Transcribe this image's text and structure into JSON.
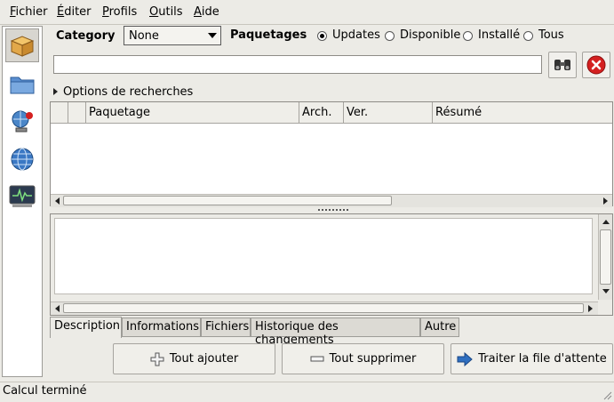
{
  "menubar": {
    "items": [
      {
        "label": "Fichier",
        "underline": "F",
        "rest": "ichier"
      },
      {
        "label": "Éditer",
        "underline": "É",
        "rest": "diter"
      },
      {
        "label": "Profils",
        "underline": "P",
        "rest": "rofils"
      },
      {
        "label": "Outils",
        "underline": "O",
        "rest": "utils"
      },
      {
        "label": "Aide",
        "underline": "A",
        "rest": "ide"
      }
    ]
  },
  "sidebar": {
    "items": [
      {
        "icon": "package-box-icon",
        "active": true
      },
      {
        "icon": "folder-icon",
        "active": false
      },
      {
        "icon": "network-update-icon",
        "active": false
      },
      {
        "icon": "globe-icon",
        "active": false
      },
      {
        "icon": "system-monitor-icon",
        "active": false
      }
    ]
  },
  "filters": {
    "category_label": "Category",
    "category_value": "None",
    "paquetages_label": "Paquetages",
    "radios": [
      {
        "label": "Updates",
        "selected": true
      },
      {
        "label": "Disponible",
        "selected": false
      },
      {
        "label": "Installé",
        "selected": false
      },
      {
        "label": "Tous",
        "selected": false
      }
    ]
  },
  "search": {
    "value": ""
  },
  "options": {
    "label": "Options de recherches"
  },
  "table": {
    "columns": [
      "",
      "",
      "Paquetage",
      "Arch.",
      "Ver.",
      "Résumé"
    ],
    "rows": []
  },
  "tabs": [
    {
      "label": "Description",
      "active": true
    },
    {
      "label": "Informations",
      "active": false
    },
    {
      "label": "Fichiers",
      "active": false
    },
    {
      "label": "Historique des changements",
      "active": false
    },
    {
      "label": "Autre",
      "active": false
    }
  ],
  "actions": {
    "add_all": "Tout ajouter",
    "remove_all": "Tout supprimer",
    "process_queue": "Traiter la file d'attente"
  },
  "status": {
    "text": "Calcul terminé"
  },
  "colors": {
    "close_red": "#d42020",
    "accent_blue": "#2f6fc0"
  }
}
